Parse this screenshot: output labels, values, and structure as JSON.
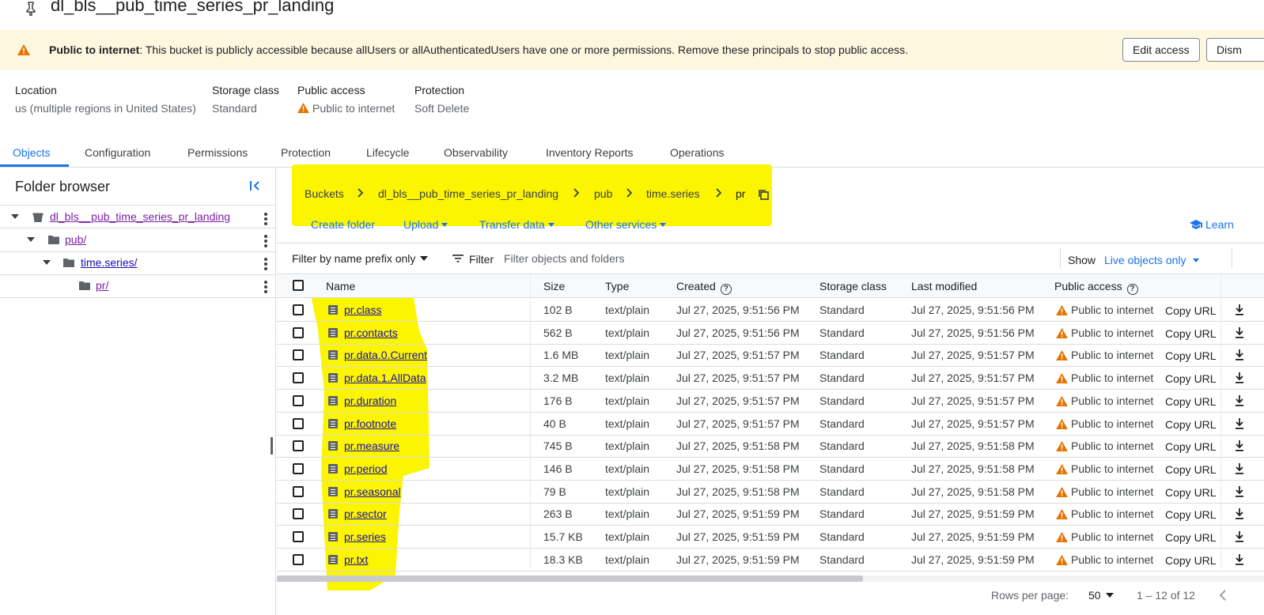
{
  "bucket_title": "dl_bls__pub_time_series_pr_landing",
  "banner": {
    "bold": "Public to internet",
    "message": ": This bucket is publicly accessible because allUsers or allAuthenticatedUsers have one or more permissions. Remove these principals to stop public access.",
    "edit_access": "Edit access",
    "dismiss": "Dism"
  },
  "info": {
    "location_label": "Location",
    "location_value": "us (multiple regions in United States)",
    "storage_label": "Storage class",
    "storage_value": "Standard",
    "public_label": "Public access",
    "public_value": "Public to internet",
    "protection_label": "Protection",
    "protection_value": "Soft Delete"
  },
  "tabs": [
    "Objects",
    "Configuration",
    "Permissions",
    "Protection",
    "Lifecycle",
    "Observability",
    "Inventory Reports",
    "Operations"
  ],
  "folder_browser": {
    "title": "Folder browser",
    "items": [
      {
        "label": "dl_bls__pub_time_series_pr_landing"
      },
      {
        "label": "pub/"
      },
      {
        "label": "time.series/"
      },
      {
        "label": "pr/"
      }
    ]
  },
  "breadcrumb": [
    "Buckets",
    "dl_bls__pub_time_series_pr_landing",
    "pub",
    "time.series",
    "pr"
  ],
  "actions": {
    "create_folder": "Create folder",
    "upload": "Upload",
    "transfer": "Transfer data",
    "other": "Other services",
    "learn": "Learn"
  },
  "filter": {
    "prefix_mode": "Filter by name prefix only",
    "label": "Filter",
    "placeholder": "Filter objects and folders",
    "show_label": "Show",
    "show_value": "Live objects only"
  },
  "table": {
    "columns": [
      "Name",
      "Size",
      "Type",
      "Created",
      "Storage class",
      "Last modified",
      "Public access"
    ],
    "copy_url": "Copy URL",
    "rows": [
      {
        "name": "pr.class",
        "size": "102 B",
        "type": "text/plain",
        "created": "Jul 27, 2025, 9:51:56 PM",
        "storage": "Standard",
        "modified": "Jul 27, 2025, 9:51:56 PM",
        "public": "Public to internet"
      },
      {
        "name": "pr.contacts",
        "size": "562 B",
        "type": "text/plain",
        "created": "Jul 27, 2025, 9:51:56 PM",
        "storage": "Standard",
        "modified": "Jul 27, 2025, 9:51:56 PM",
        "public": "Public to internet"
      },
      {
        "name": "pr.data.0.Current",
        "size": "1.6 MB",
        "type": "text/plain",
        "created": "Jul 27, 2025, 9:51:57 PM",
        "storage": "Standard",
        "modified": "Jul 27, 2025, 9:51:57 PM",
        "public": "Public to internet"
      },
      {
        "name": "pr.data.1.AllData",
        "size": "3.2 MB",
        "type": "text/plain",
        "created": "Jul 27, 2025, 9:51:57 PM",
        "storage": "Standard",
        "modified": "Jul 27, 2025, 9:51:57 PM",
        "public": "Public to internet"
      },
      {
        "name": "pr.duration",
        "size": "176 B",
        "type": "text/plain",
        "created": "Jul 27, 2025, 9:51:57 PM",
        "storage": "Standard",
        "modified": "Jul 27, 2025, 9:51:57 PM",
        "public": "Public to internet"
      },
      {
        "name": "pr.footnote",
        "size": "40 B",
        "type": "text/plain",
        "created": "Jul 27, 2025, 9:51:57 PM",
        "storage": "Standard",
        "modified": "Jul 27, 2025, 9:51:57 PM",
        "public": "Public to internet"
      },
      {
        "name": "pr.measure",
        "size": "745 B",
        "type": "text/plain",
        "created": "Jul 27, 2025, 9:51:58 PM",
        "storage": "Standard",
        "modified": "Jul 27, 2025, 9:51:58 PM",
        "public": "Public to internet"
      },
      {
        "name": "pr.period",
        "size": "146 B",
        "type": "text/plain",
        "created": "Jul 27, 2025, 9:51:58 PM",
        "storage": "Standard",
        "modified": "Jul 27, 2025, 9:51:58 PM",
        "public": "Public to internet"
      },
      {
        "name": "pr.seasonal",
        "size": "79 B",
        "type": "text/plain",
        "created": "Jul 27, 2025, 9:51:58 PM",
        "storage": "Standard",
        "modified": "Jul 27, 2025, 9:51:58 PM",
        "public": "Public to internet"
      },
      {
        "name": "pr.sector",
        "size": "263 B",
        "type": "text/plain",
        "created": "Jul 27, 2025, 9:51:59 PM",
        "storage": "Standard",
        "modified": "Jul 27, 2025, 9:51:59 PM",
        "public": "Public to internet"
      },
      {
        "name": "pr.series",
        "size": "15.7 KB",
        "type": "text/plain",
        "created": "Jul 27, 2025, 9:51:59 PM",
        "storage": "Standard",
        "modified": "Jul 27, 2025, 9:51:59 PM",
        "public": "Public to internet"
      },
      {
        "name": "pr.txt",
        "size": "18.3 KB",
        "type": "text/plain",
        "created": "Jul 27, 2025, 9:51:59 PM",
        "storage": "Standard",
        "modified": "Jul 27, 2025, 9:51:59 PM",
        "public": "Public to internet"
      }
    ]
  },
  "pager": {
    "rows_label": "Rows per page:",
    "rows_value": "50",
    "range": "1 – 12 of 12"
  },
  "colors": {
    "accent": "#1a73e8",
    "warning": "#e37400",
    "banner_bg": "#fef7e0",
    "highlight": "#fbf500"
  }
}
